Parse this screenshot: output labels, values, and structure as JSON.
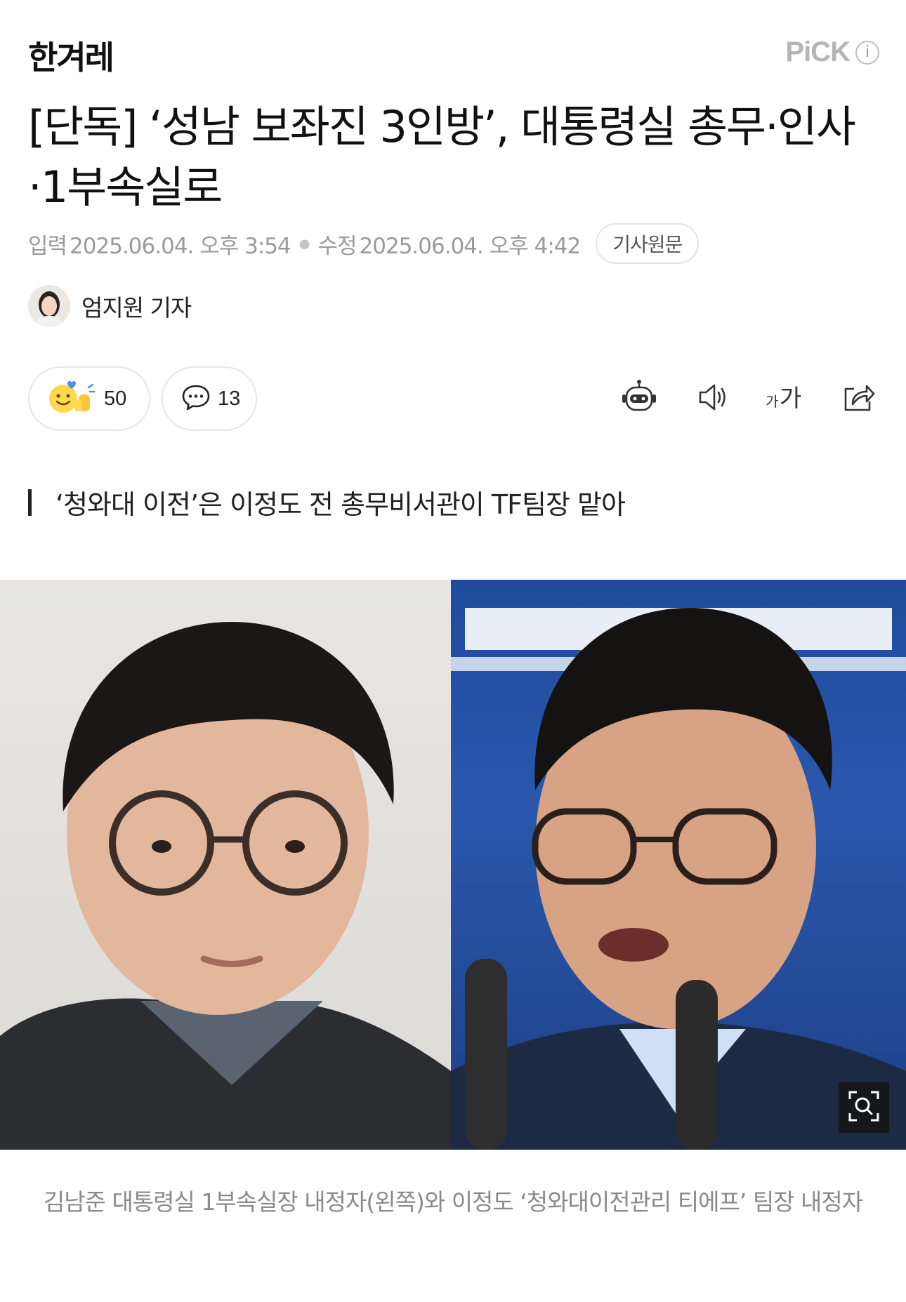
{
  "header": {
    "logo": "한겨레",
    "pick_label": "PiCK",
    "pick_info": "i"
  },
  "article": {
    "title": "[단독] ‘성남 보좌진 3인방’, 대통령실 총무·인사·1부속실로",
    "meta": {
      "input_label": "입력",
      "input_time": "2025.06.04. 오후 3:54",
      "edit_label": "수정",
      "edit_time": "2025.06.04. 오후 4:42",
      "original_button": "기사원문"
    },
    "reporter": "엄지원 기자",
    "reactions": {
      "icon": "emoji-reaction-icon",
      "count": "50"
    },
    "comments": {
      "icon": "comment-icon",
      "count": "13"
    },
    "tools": {
      "summary_icon": "robot-summary-icon",
      "audio_icon": "speaker-icon",
      "font_size_icon": "font-size-icon",
      "share_icon": "share-icon"
    },
    "subtitle": "‘청와대 이전’은 이정도 전 총무비서관이 TF팀장 맡아",
    "photo": {
      "zoom_icon": "zoom-icon"
    },
    "caption": "김남준 대통령실 1부속실장 내정자(왼쪽)와 이정도 ‘청와대이전관리 티에프’ 팀장 내정자"
  }
}
